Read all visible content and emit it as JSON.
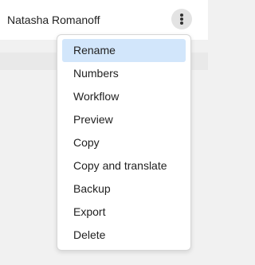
{
  "header": {
    "name": "Natasha Romanoff",
    "more_icon": "more-vertical-icon"
  },
  "menu": {
    "items": [
      {
        "label": "Rename",
        "highlighted": true
      },
      {
        "label": "Numbers"
      },
      {
        "label": "Workflow"
      },
      {
        "label": "Preview"
      },
      {
        "label": "Copy"
      },
      {
        "label": "Copy and translate"
      },
      {
        "label": "Backup"
      },
      {
        "label": "Export"
      },
      {
        "label": "Delete"
      }
    ]
  },
  "colors": {
    "highlight": "#d2e6fb",
    "background": "#f1f1f1"
  }
}
